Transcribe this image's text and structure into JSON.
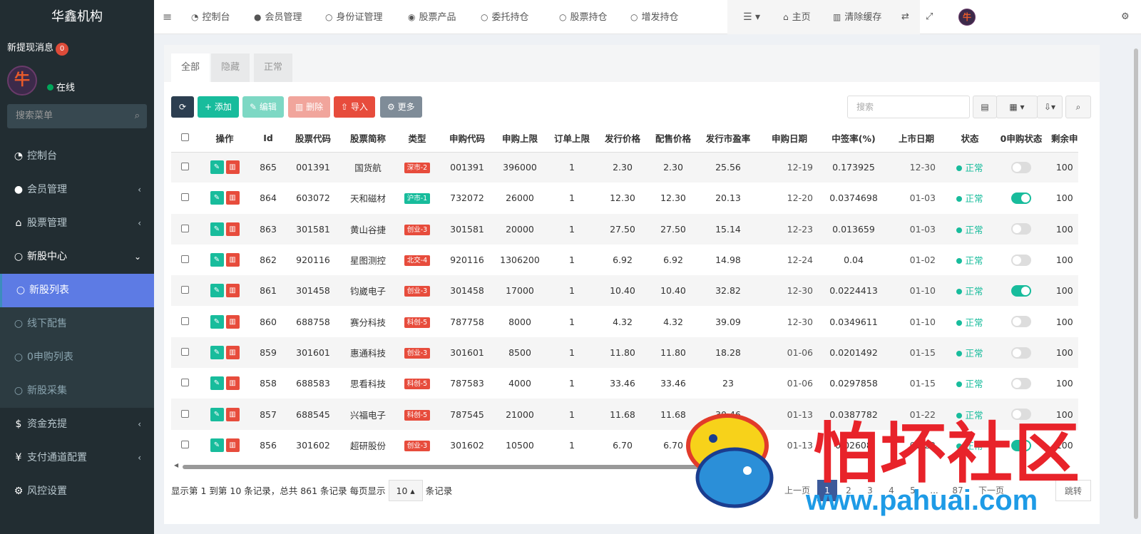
{
  "sidebar": {
    "title": "华鑫机构",
    "new_msg_label": "新提现消息",
    "new_msg_count": "0",
    "status": "在线",
    "search_placeholder": "搜索菜单",
    "items": [
      {
        "label": "控制台",
        "icon": "dashboard-icon"
      },
      {
        "label": "会员管理",
        "icon": "user-icon"
      },
      {
        "label": "股票管理",
        "icon": "bank-icon"
      },
      {
        "label": "新股中心",
        "icon": "circle-icon"
      },
      {
        "label": "新股列表",
        "icon": "circle-icon"
      },
      {
        "label": "线下配售",
        "icon": "circle-icon"
      },
      {
        "label": "0申购列表",
        "icon": "circle-icon"
      },
      {
        "label": "新股采集",
        "icon": "circle-icon"
      },
      {
        "label": "资金充提",
        "icon": "dollar-icon"
      },
      {
        "label": "支付通道配置",
        "icon": "yen-icon"
      },
      {
        "label": "风控设置",
        "icon": "gear-icon"
      },
      {
        "label": "...",
        "icon": "gear-icon"
      }
    ]
  },
  "topbar": {
    "nav": [
      "控制台",
      "会员管理",
      "身份证管理",
      "股票产品",
      "委托持仓",
      "股票持仓",
      "增发持仓"
    ],
    "home": "主页",
    "clear_cache": "清除缓存"
  },
  "tabs": [
    "全部",
    "隐藏",
    "正常"
  ],
  "toolbar": {
    "refresh": "",
    "add": "添加",
    "edit": "编辑",
    "delete": "删除",
    "import": "导入",
    "more": "更多",
    "search_placeholder": "搜索"
  },
  "table": {
    "headers": [
      "操作",
      "Id",
      "股票代码",
      "股票简称",
      "类型",
      "申购代码",
      "申购上限",
      "订单上限",
      "发行价格",
      "配售价格",
      "发行市盈率",
      "申购日期",
      "中签率(%)",
      "上市日期",
      "状态",
      "0申购状态",
      "剩余申"
    ],
    "rows": [
      {
        "id": "865",
        "code": "001391",
        "name": "国货航",
        "type": "深市-2",
        "type_color": "#e74c3c",
        "sub_code": "001391",
        "sub_limit": "396000",
        "order_limit": "1",
        "price": "2.30",
        "place_price": "2.30",
        "pe": "25.56",
        "sub_date": "12-19",
        "rate": "0.173925",
        "list_date": "12-30",
        "status": "正常",
        "zero": false,
        "rest": "100"
      },
      {
        "id": "864",
        "code": "603072",
        "name": "天和磁材",
        "type": "沪市-1",
        "type_color": "#18bc9c",
        "sub_code": "732072",
        "sub_limit": "26000",
        "order_limit": "1",
        "price": "12.30",
        "place_price": "12.30",
        "pe": "20.13",
        "sub_date": "12-20",
        "rate": "0.0374698",
        "list_date": "01-03",
        "status": "正常",
        "zero": true,
        "rest": "100"
      },
      {
        "id": "863",
        "code": "301581",
        "name": "黄山谷捷",
        "type": "创业-3",
        "type_color": "#e74c3c",
        "sub_code": "301581",
        "sub_limit": "20000",
        "order_limit": "1",
        "price": "27.50",
        "place_price": "27.50",
        "pe": "15.14",
        "sub_date": "12-23",
        "rate": "0.013659",
        "list_date": "01-03",
        "status": "正常",
        "zero": false,
        "rest": "100"
      },
      {
        "id": "862",
        "code": "920116",
        "name": "星图测控",
        "type": "北交-4",
        "type_color": "#e74c3c",
        "sub_code": "920116",
        "sub_limit": "1306200",
        "order_limit": "1",
        "price": "6.92",
        "place_price": "6.92",
        "pe": "14.98",
        "sub_date": "12-24",
        "rate": "0.04",
        "list_date": "01-02",
        "status": "正常",
        "zero": false,
        "rest": "100"
      },
      {
        "id": "861",
        "code": "301458",
        "name": "钧崴电子",
        "type": "创业-3",
        "type_color": "#e74c3c",
        "sub_code": "301458",
        "sub_limit": "17000",
        "order_limit": "1",
        "price": "10.40",
        "place_price": "10.40",
        "pe": "32.82",
        "sub_date": "12-30",
        "rate": "0.0224413",
        "list_date": "01-10",
        "status": "正常",
        "zero": true,
        "rest": "100"
      },
      {
        "id": "860",
        "code": "688758",
        "name": "赛分科技",
        "type": "科创-5",
        "type_color": "#e74c3c",
        "sub_code": "787758",
        "sub_limit": "8000",
        "order_limit": "1",
        "price": "4.32",
        "place_price": "4.32",
        "pe": "39.09",
        "sub_date": "12-30",
        "rate": "0.0349611",
        "list_date": "01-10",
        "status": "正常",
        "zero": false,
        "rest": "100"
      },
      {
        "id": "859",
        "code": "301601",
        "name": "惠通科技",
        "type": "创业-3",
        "type_color": "#e74c3c",
        "sub_code": "301601",
        "sub_limit": "8500",
        "order_limit": "1",
        "price": "11.80",
        "place_price": "11.80",
        "pe": "18.28",
        "sub_date": "01-06",
        "rate": "0.0201492",
        "list_date": "01-15",
        "status": "正常",
        "zero": false,
        "rest": "100"
      },
      {
        "id": "858",
        "code": "688583",
        "name": "思看科技",
        "type": "科创-5",
        "type_color": "#e74c3c",
        "sub_code": "787583",
        "sub_limit": "4000",
        "order_limit": "1",
        "price": "33.46",
        "place_price": "33.46",
        "pe": "23",
        "sub_date": "01-06",
        "rate": "0.0297858",
        "list_date": "01-15",
        "status": "正常",
        "zero": false,
        "rest": "100"
      },
      {
        "id": "857",
        "code": "688545",
        "name": "兴福电子",
        "type": "科创-5",
        "type_color": "#e74c3c",
        "sub_code": "787545",
        "sub_limit": "21000",
        "order_limit": "1",
        "price": "11.68",
        "place_price": "11.68",
        "pe": "30.46",
        "sub_date": "01-13",
        "rate": "0.0387782",
        "list_date": "01-22",
        "status": "正常",
        "zero": false,
        "rest": "100"
      },
      {
        "id": "856",
        "code": "301602",
        "name": "超研股份",
        "type": "创业-3",
        "type_color": "#e74c3c",
        "sub_code": "301602",
        "sub_limit": "10500",
        "order_limit": "1",
        "price": "6.70",
        "place_price": "6.70",
        "pe": "",
        "sub_date": "01-13",
        "rate": "0.02608",
        "list_date": "01-22",
        "status": "正常",
        "zero": true,
        "rest": "100"
      }
    ]
  },
  "footer": {
    "info_prefix": "显示第 1 到第 10 条记录，总共 861 条记录 每页显示",
    "page_size": "10",
    "info_suffix": "条记录",
    "prev": "上一页",
    "pages": [
      "1",
      "2",
      "3",
      "4",
      "5",
      "...",
      "87"
    ],
    "next": "下一页",
    "jump": "跳转"
  },
  "watermark": {
    "text": "怕坏社区",
    "url": "www.pahuai.com"
  }
}
